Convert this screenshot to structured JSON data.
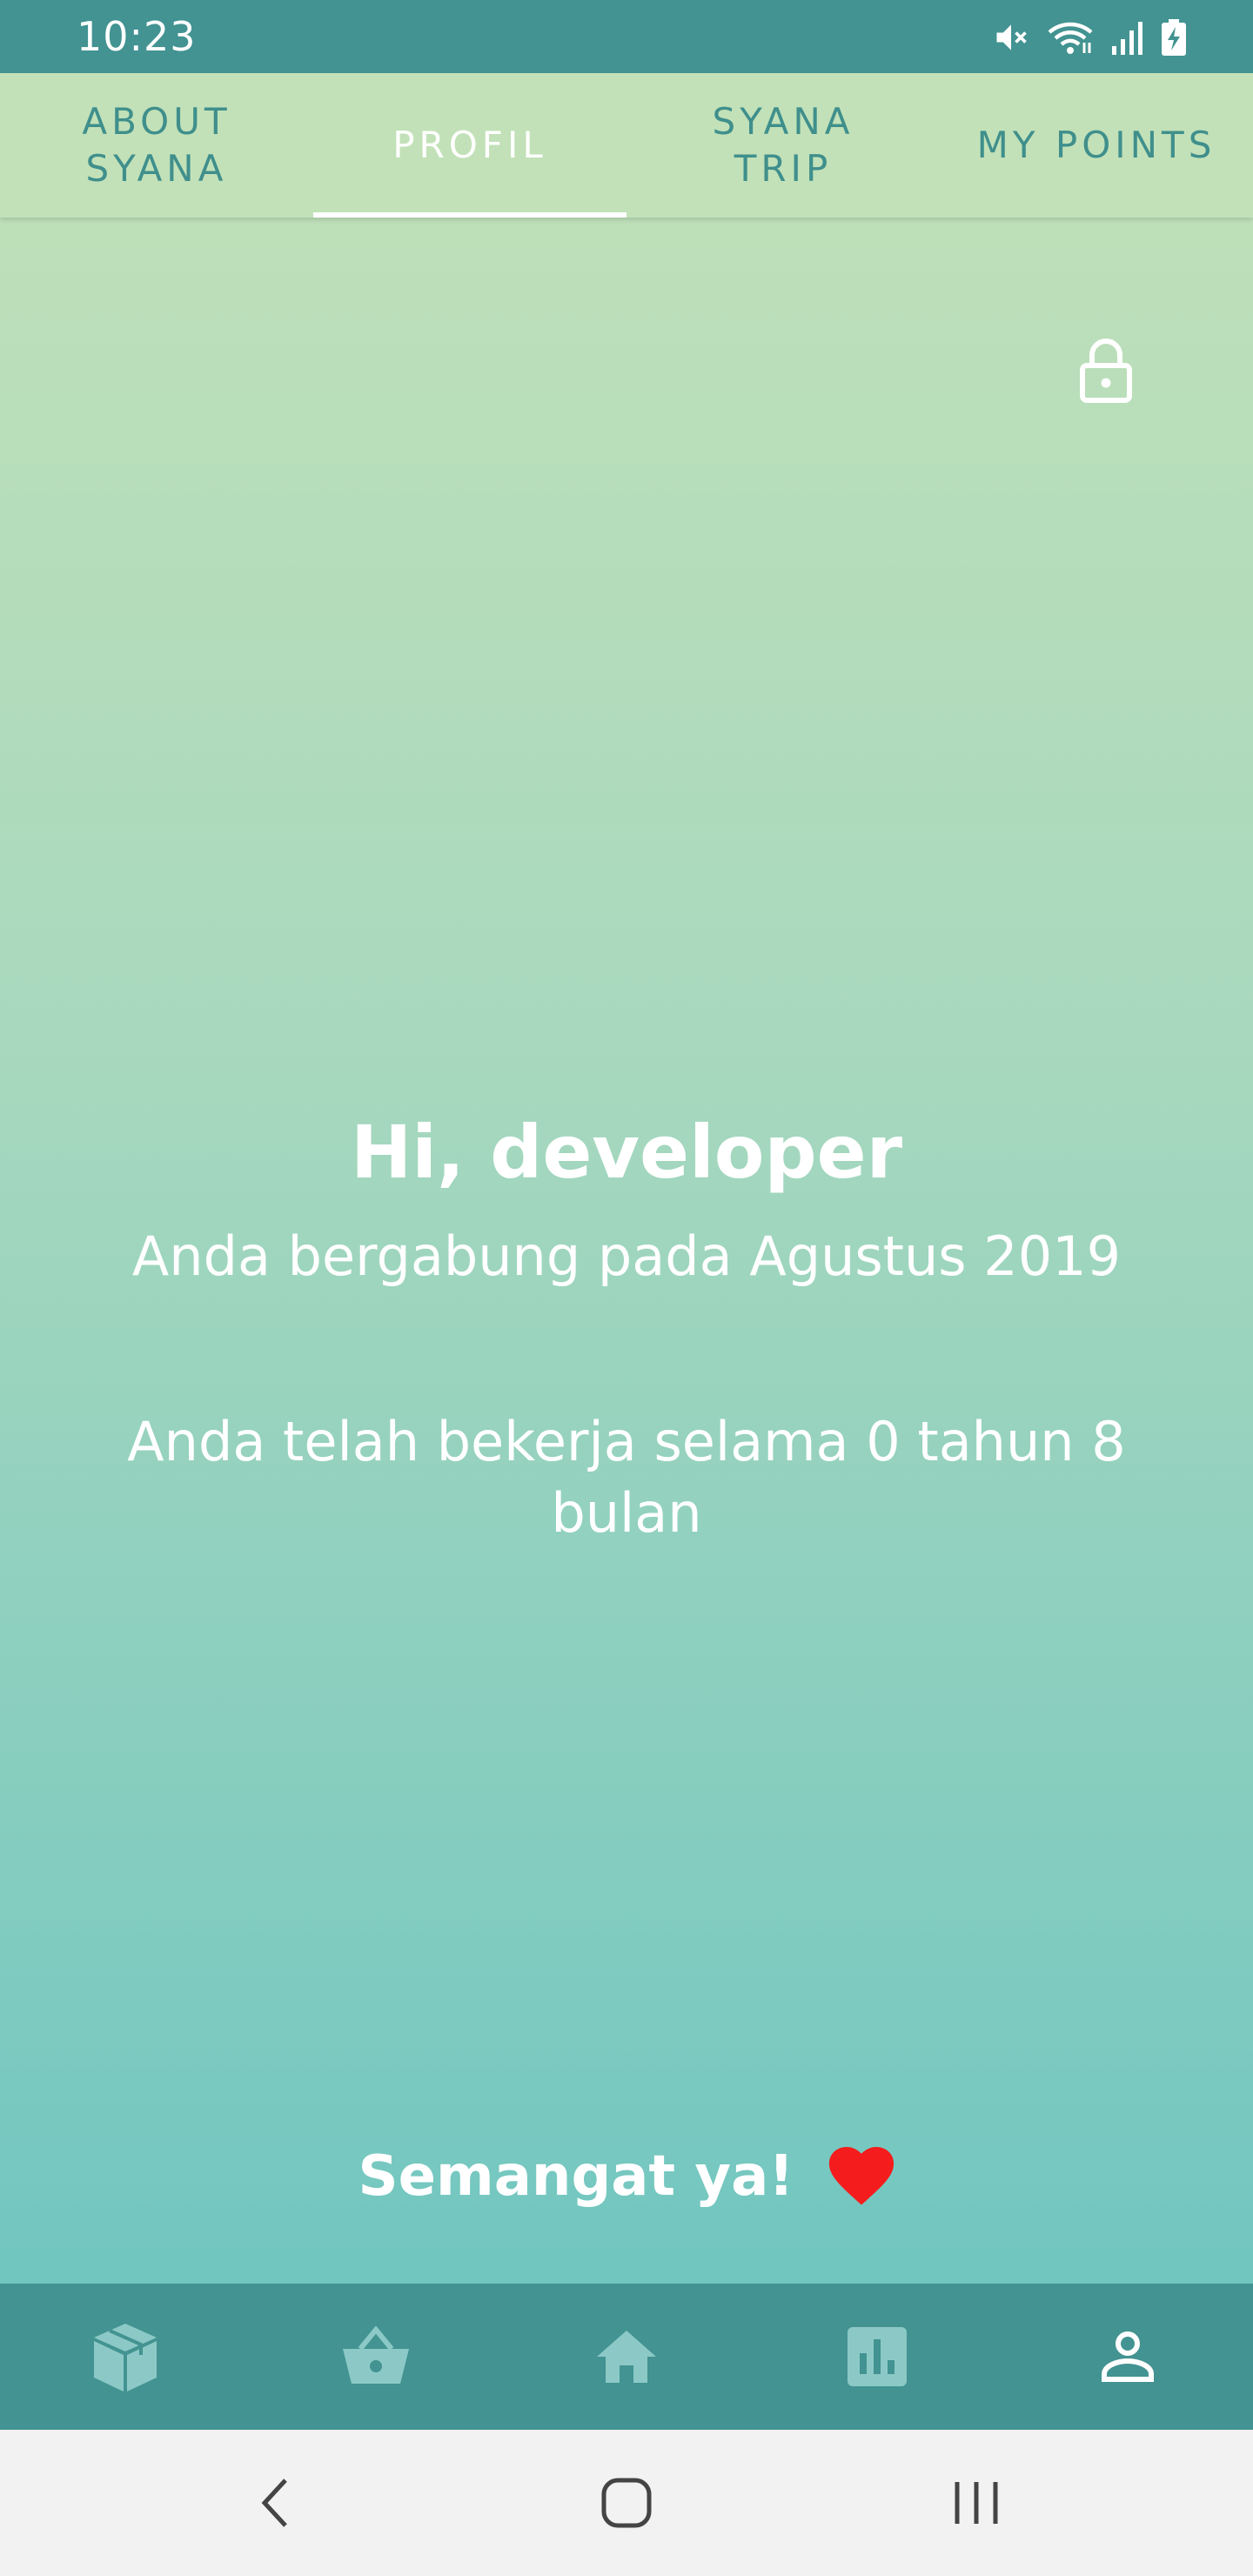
{
  "status_bar": {
    "time": "10:23",
    "icons": [
      "mute-icon",
      "wifi-icon",
      "signal-icon",
      "battery-charging-icon"
    ]
  },
  "tabs": [
    {
      "label": "ABOUT\nSYANA",
      "active": false
    },
    {
      "label": "PROFIL",
      "active": true
    },
    {
      "label": "SYANA\nTRIP",
      "active": false
    },
    {
      "label": "MY POINTS",
      "active": false
    }
  ],
  "profile": {
    "greeting": "Hi, developer",
    "joined": "Anda bergabung pada Agustus 2019",
    "worked": "Anda telah bekerja selama 0 tahun 8 bulan",
    "encouragement": "Semangat ya!"
  },
  "bottom_nav": {
    "items": [
      "box-icon",
      "basket-icon",
      "home-icon",
      "chart-icon",
      "person-icon"
    ],
    "active": "person-icon"
  },
  "system_nav": [
    "back-icon",
    "home-button-icon",
    "recents-icon"
  ],
  "colors": {
    "primary": "#429391",
    "tab_bar": "#c2e1b8",
    "gradient_top": "#c2e1b8",
    "gradient_bottom": "#71c6c0",
    "heart": "#f41c1c",
    "inactive_icon": "#8cc9c6"
  }
}
